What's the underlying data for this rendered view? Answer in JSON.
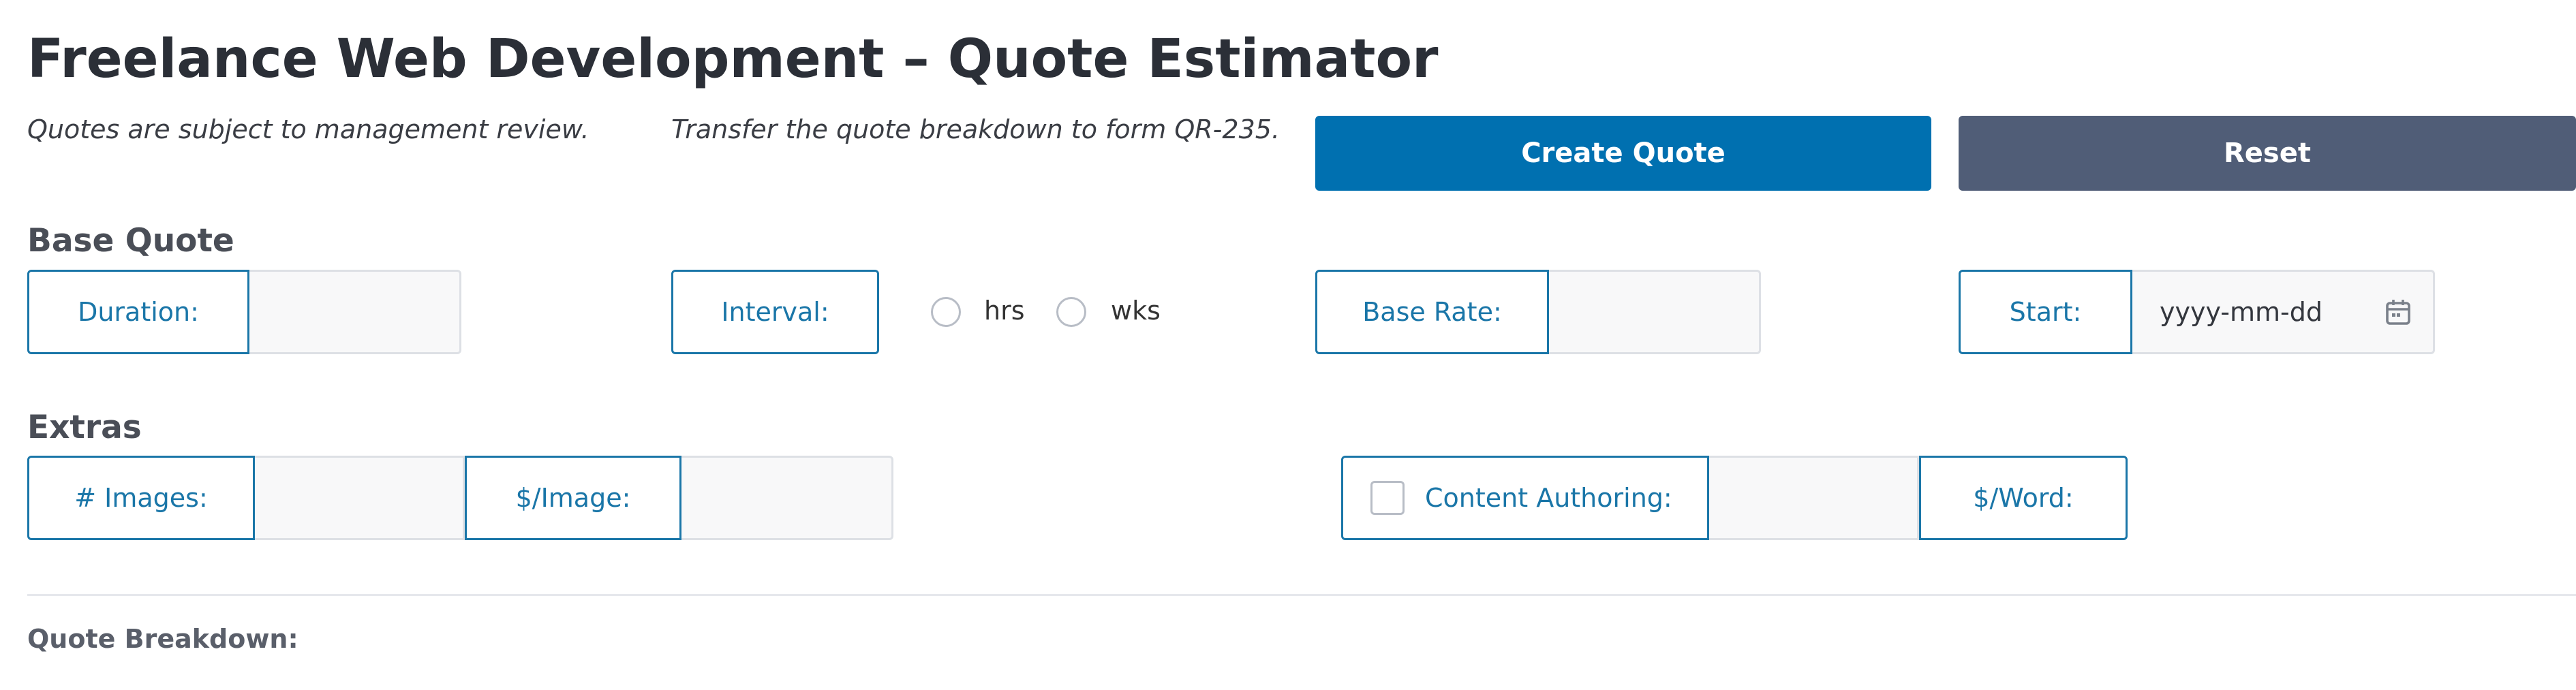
{
  "header": {
    "title": "Freelance Web Development – Quote Estimator",
    "note_review": "Quotes are subject to management review.",
    "note_transfer": "Transfer the quote breakdown to form QR-235."
  },
  "actions": {
    "create_label": "Create Quote",
    "reset_label": "Reset"
  },
  "base_quote": {
    "heading": "Base Quote",
    "duration_label": "Duration:",
    "duration_value": "",
    "interval_label": "Interval:",
    "interval_options": [
      "hrs",
      "wks"
    ],
    "base_rate_label": "Base Rate:",
    "base_rate_value": "",
    "start_label": "Start:",
    "start_placeholder": "yyyy-mm-dd"
  },
  "extras": {
    "heading": "Extras",
    "images_label": "# Images:",
    "images_value": "",
    "per_image_label": "$/Image:",
    "per_image_value": "",
    "content_label": "Content Authoring:",
    "content_value": "",
    "per_word_label": "$/Word:"
  },
  "breakdown": {
    "heading": "Quote Breakdown:"
  },
  "colors": {
    "primary": "#0070b0",
    "reset": "#505d77",
    "label_border": "#1a76a8"
  },
  "icons": {
    "date": "calendar-icon"
  }
}
